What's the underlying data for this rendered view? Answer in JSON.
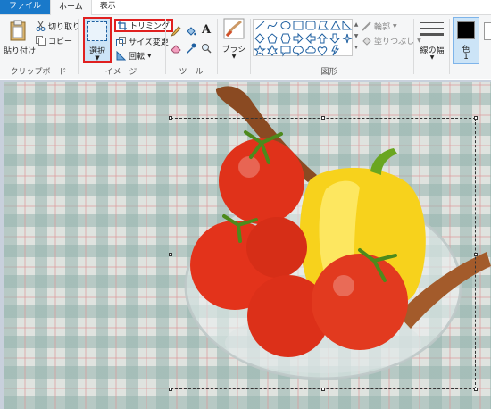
{
  "tabs": [
    {
      "label": "ファイル"
    },
    {
      "label": "ホーム"
    },
    {
      "label": "表示"
    }
  ],
  "clipboard": {
    "paste_label": "貼り付け",
    "cut_label": "切り取り",
    "copy_label": "コピー",
    "group_label": "クリップボード"
  },
  "image": {
    "select_label": "選択",
    "trim_label": "トリミング",
    "resize_label": "サイズ変更",
    "rotate_label": "回転",
    "group_label": "イメージ"
  },
  "tools": {
    "group_label": "ツール"
  },
  "brush": {
    "label": "ブラシ"
  },
  "shapes": {
    "outline_label": "輪郭",
    "fill_label": "塗りつぶし",
    "group_label": "図形"
  },
  "size": {
    "label": "線の幅"
  },
  "color": {
    "label": "色",
    "sublabel": "1",
    "active_color": "#000000"
  },
  "colors": {
    "accent": "#1979ca",
    "highlight": "#e02020",
    "selected_bg": "#cce4f7"
  }
}
